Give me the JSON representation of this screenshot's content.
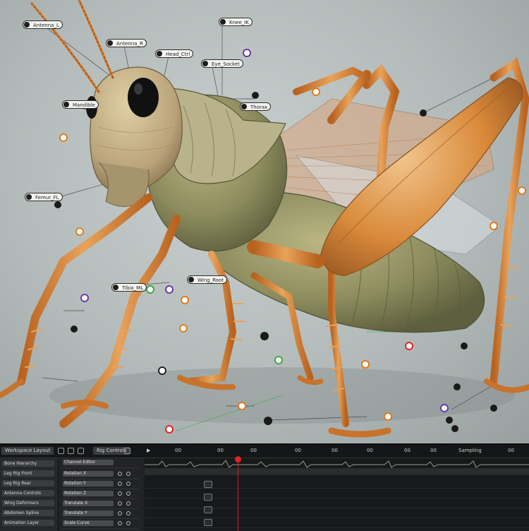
{
  "toolbar": {
    "tabs": [
      "Workspace Layout",
      "Rig Controls"
    ],
    "frame_labels": [
      "▶",
      "00",
      "00",
      "00",
      "00",
      "00",
      "00",
      "00",
      "00",
      "Sampling",
      "00"
    ]
  },
  "layers_panel": {
    "rows": [
      "Bone Hierarchy",
      "Leg Rig Front",
      "Leg Rig Rear",
      "Antenna Controls",
      "Wing Deformers",
      "Abdomen Spline",
      "Animation Layer"
    ]
  },
  "channel_panel": {
    "header": "Channel Editor",
    "rows": [
      "Rotation X",
      "Rotation Y",
      "Rotation Z",
      "Translate X",
      "Translate Y",
      "Scale Curve"
    ]
  },
  "scene": {
    "callouts": [
      "Antenna_L",
      "Antenna_R",
      "Head_Ctrl",
      "Eye_Socket",
      "Mandible",
      "Thorax",
      "Femur_FL",
      "Tibia_ML",
      "Wing_Root",
      "Knee_IK"
    ]
  },
  "colors": {
    "body": "#9a9a6c",
    "legs": "#d98a3a",
    "wing": "#c9a07a",
    "playhead": "#e02222",
    "panel_bg": "#1e1f21"
  }
}
